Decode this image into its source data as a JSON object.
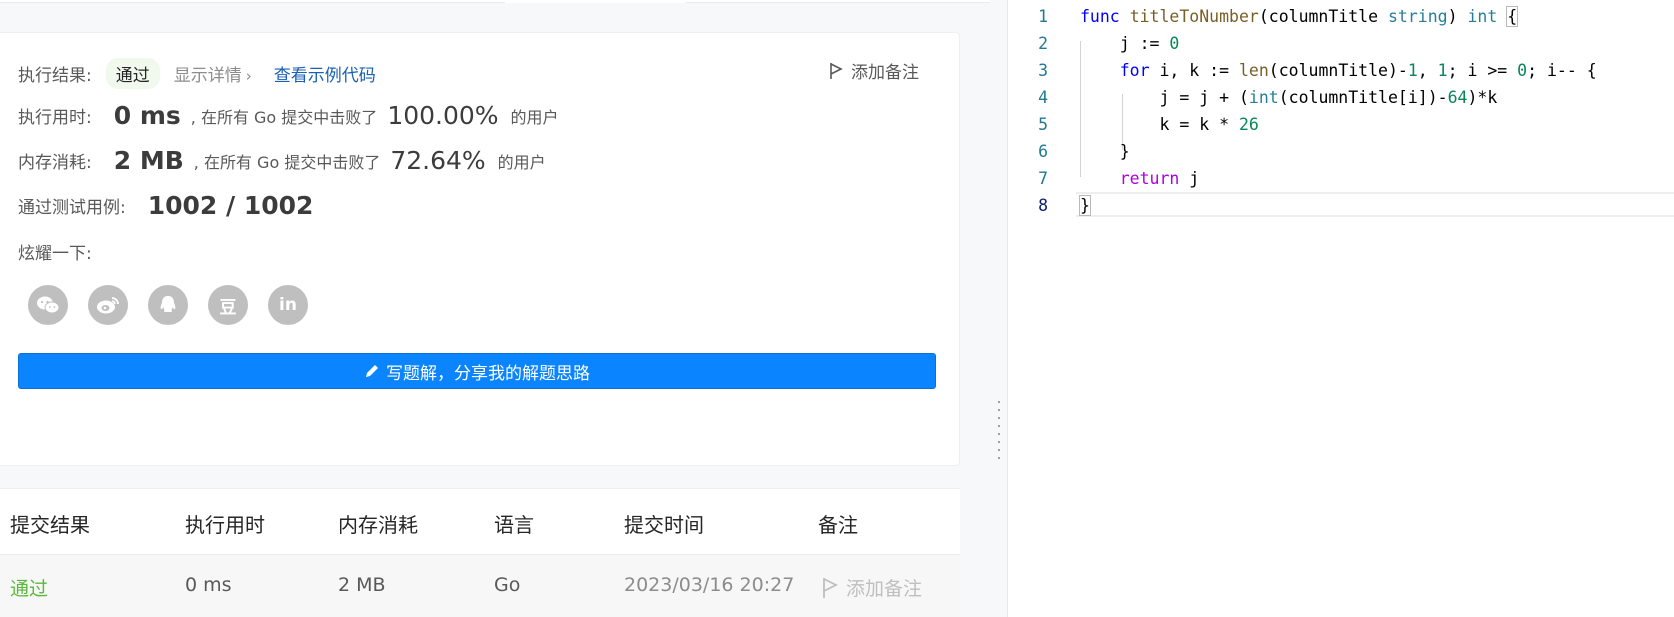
{
  "result": {
    "status_label": "执行结果:",
    "status_value": "通过",
    "show_detail": "显示详情",
    "view_sample": "查看示例代码",
    "add_note": "添加备注",
    "runtime_label": "执行用时:",
    "runtime_value": "0 ms",
    "runtime_text": ", 在所有 Go 提交中击败了",
    "runtime_pct": "100.00%",
    "runtime_suffix": "的用户",
    "memory_label": "内存消耗:",
    "memory_value": "2 MB",
    "memory_text": ", 在所有 Go 提交中击败了",
    "memory_pct": "72.64%",
    "memory_suffix": "的用户",
    "cases_label": "通过测试用例:",
    "cases_value": "1002 / 1002",
    "share_label": "炫耀一下:",
    "share_icons": [
      "wechat-icon",
      "weibo-icon",
      "qq-icon",
      "douban-icon",
      "linkedin-icon"
    ],
    "douban_glyph": "豆",
    "linkedin_glyph": "in",
    "write_solution": "写题解，分享我的解题思路"
  },
  "table": {
    "headers": [
      "提交结果",
      "执行用时",
      "内存消耗",
      "语言",
      "提交时间",
      "备注"
    ],
    "row": {
      "result": "通过",
      "runtime": "0 ms",
      "memory": "2 MB",
      "language": "Go",
      "time": "2023/03/16 20:27",
      "note": "添加备注"
    }
  },
  "editor": {
    "line_numbers": [
      "1",
      "2",
      "3",
      "4",
      "5",
      "6",
      "7",
      "8"
    ],
    "code": [
      "func titleToNumber(columnTitle string) int {",
      "    j := 0",
      "    for i, k := len(columnTitle)-1, 1; i >= 0; i-- {",
      "        j = j + (int(columnTitle[i])-64)*k",
      "        k = k * 26",
      "    }",
      "    return j",
      "}"
    ]
  },
  "colors": {
    "accent": "#0a84ff",
    "pass": "#5cb83c",
    "link": "#1a5fb4"
  }
}
